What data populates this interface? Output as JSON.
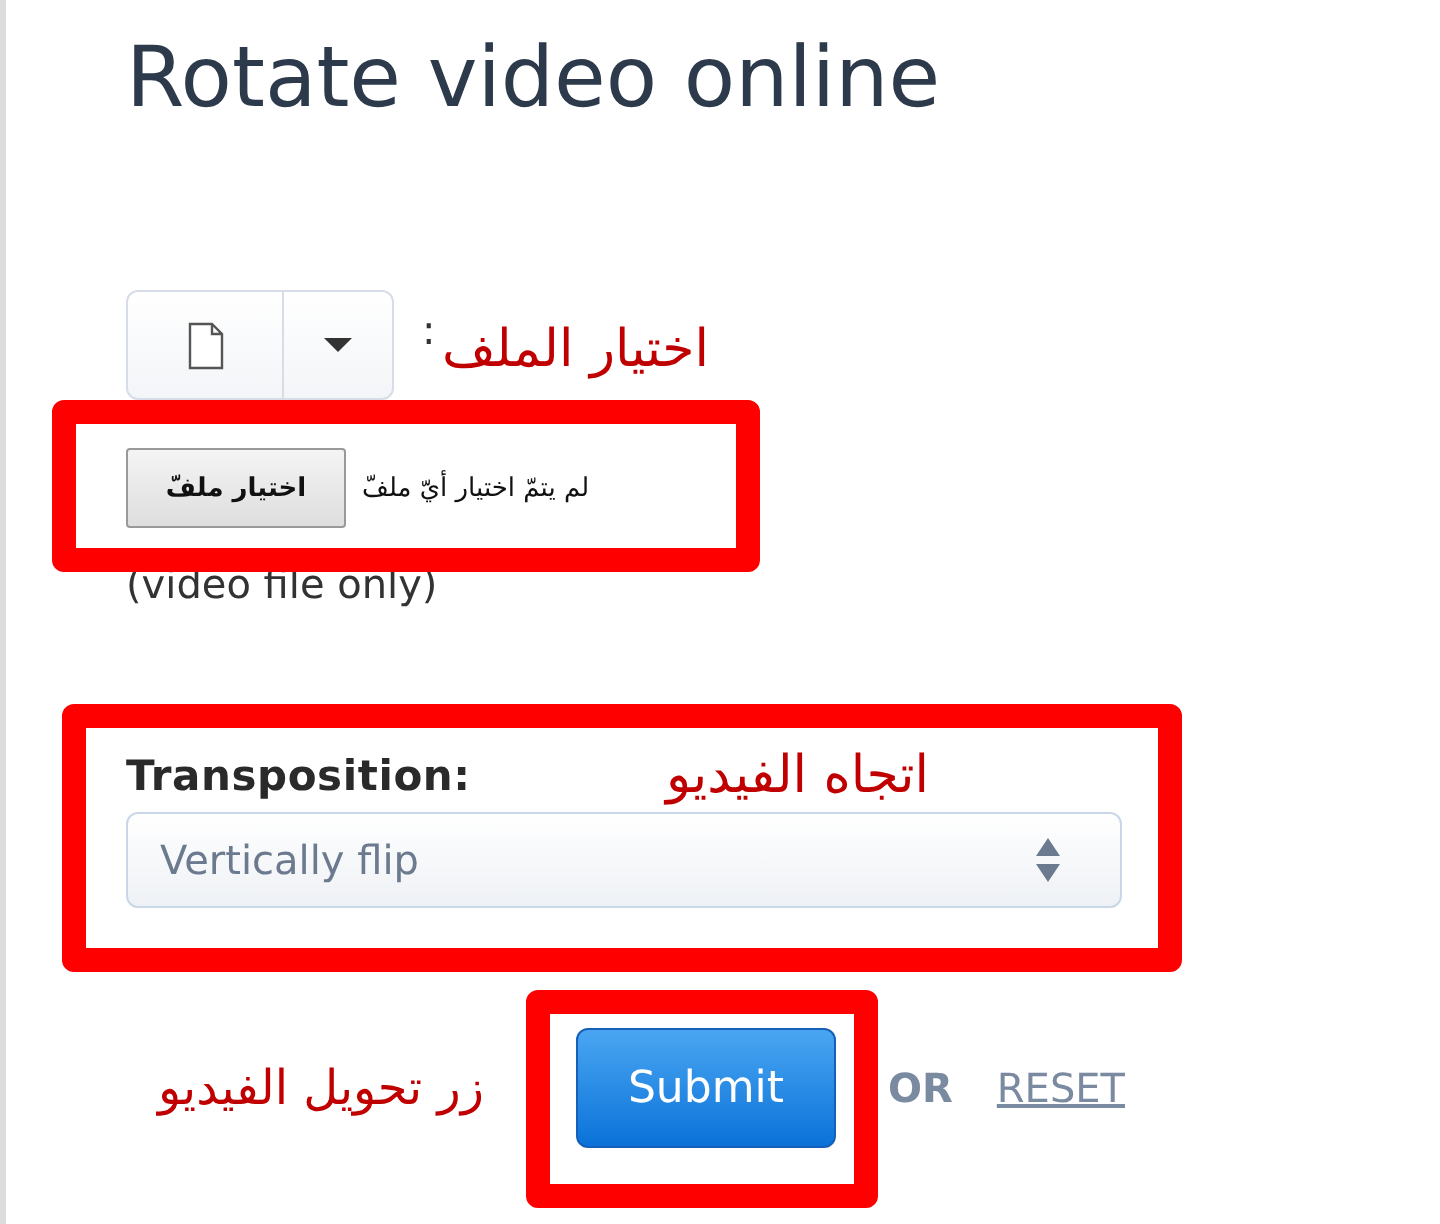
{
  "title": "Rotate video online",
  "file_source": {
    "separator": ":"
  },
  "file_input": {
    "button": "اختيار ملفّ",
    "status": "لم يتمّ اختيار أيّ ملفّ"
  },
  "file_hint": "(video file only)",
  "transposition": {
    "label": "Transposition:",
    "value": "Vertically flip"
  },
  "actions": {
    "submit": "Submit",
    "or": "OR",
    "reset": "RESET"
  },
  "annotations": [
    {
      "kind": "label",
      "text": "اختيار الملف"
    },
    {
      "kind": "frame"
    },
    {
      "kind": "frame"
    },
    {
      "kind": "label",
      "text": "اتجاه الفيديو"
    },
    {
      "kind": "frame"
    },
    {
      "kind": "label",
      "text": "زر تحويل الفيديو"
    }
  ]
}
